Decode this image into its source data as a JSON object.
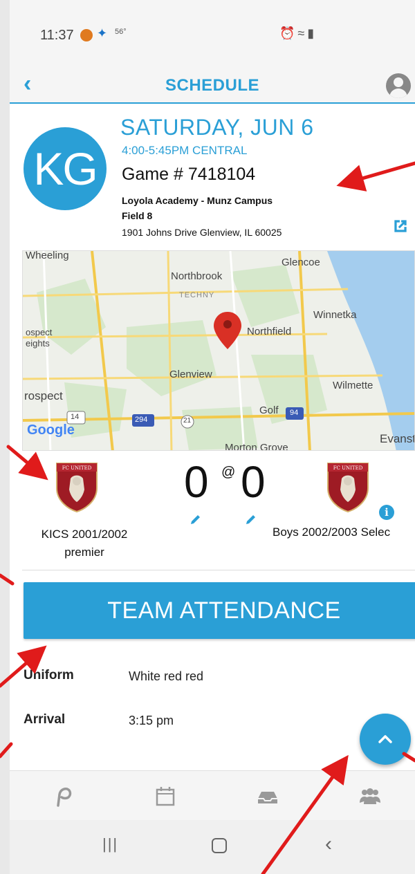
{
  "status_bar": {
    "time": "11:37",
    "temperature": "56°"
  },
  "header": {
    "title": "SCHEDULE"
  },
  "game": {
    "team_initials": "KG",
    "date": "SATURDAY, JUN 6",
    "time": "4:00-5:45PM CENTRAL",
    "game_number": "Game # 7418104",
    "venue": "Loyola Academy - Munz Campus",
    "field": "Field 8",
    "address": "1901 Johns Drive  Glenview, IL 60025"
  },
  "map": {
    "labels": {
      "wheeling": "Wheeling",
      "glencoe": "Glencoe",
      "northbrook": "Northbrook",
      "techny": "TECHNY",
      "winnetka": "Winnetka",
      "prospect_heights_1": "ospect",
      "prospect_heights_2": "eights",
      "northfield": "Northfield",
      "glenview": "Glenview",
      "wilmette": "Wilmette",
      "prospect": "rospect",
      "golf": "Golf",
      "evanston": "Evanst",
      "morton_grove": "Morton Grove",
      "route_14": "14",
      "route_294": "294",
      "route_21": "21",
      "route_94": "94"
    },
    "attribution": "Google"
  },
  "match": {
    "home_team": "KICS 2001/2002 premier",
    "away_team": "Boys 2002/2003 Selec",
    "home_score": "0",
    "away_score": "0",
    "separator": "@"
  },
  "attendance_button": "TEAM ATTENDANCE",
  "details": {
    "uniform_label": "Uniform",
    "uniform_value": "White red red",
    "arrival_label": "Arrival",
    "arrival_value": "3:15 pm"
  },
  "colors": {
    "accent": "#2a9fd6",
    "annotation": "#e01b1b"
  },
  "icons": {
    "back": "chevron-left-icon",
    "profile": "account-circle-icon",
    "external_link": "open-in-new-icon",
    "edit": "pencil-icon",
    "info": "info-icon",
    "fab": "chevron-up-icon",
    "nav": [
      "home-icon",
      "calendar-icon",
      "inbox-icon",
      "team-icon"
    ],
    "system_nav": [
      "recent-apps-icon",
      "home-button-icon",
      "back-icon"
    ]
  }
}
